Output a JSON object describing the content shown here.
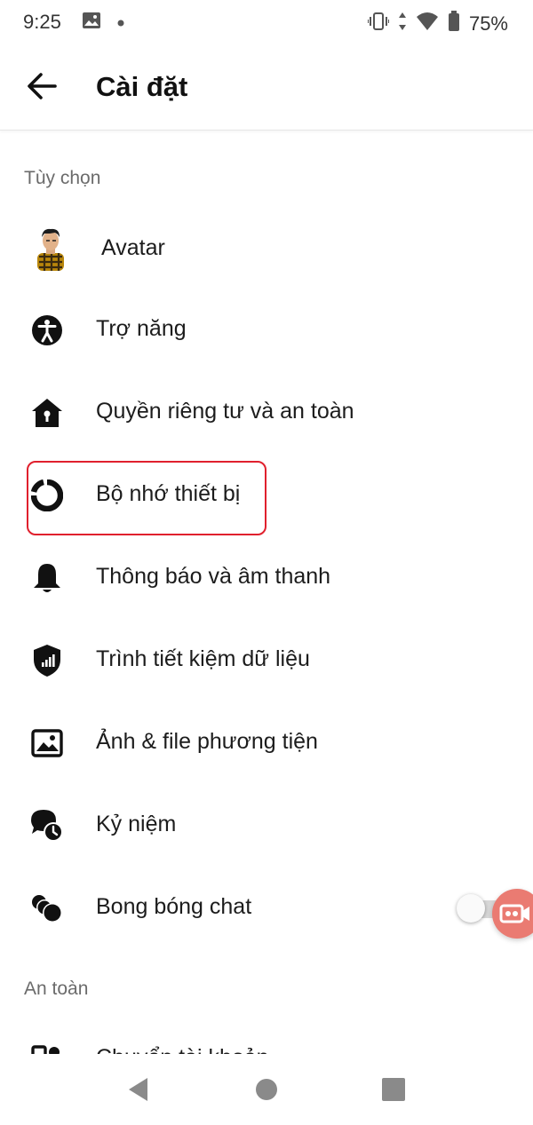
{
  "status_bar": {
    "time": "9:25",
    "battery": "75%",
    "icons": [
      "image-icon",
      "dot-icon",
      "vibrate-icon",
      "data-arrows-icon",
      "wifi-icon",
      "battery-icon"
    ]
  },
  "header": {
    "title": "Cài đặt",
    "back_icon": "arrow-left-icon"
  },
  "sections": {
    "preferences": {
      "title": "Tùy chọn",
      "items": [
        {
          "label": "Avatar",
          "icon": "avatar-image"
        },
        {
          "label": "Trợ năng",
          "icon": "accessibility-icon"
        },
        {
          "label": "Quyền riêng tư và an toàn",
          "icon": "privacy-house-icon"
        },
        {
          "label": "Bộ nhớ thiết bị",
          "icon": "storage-ring-icon",
          "highlighted": true
        },
        {
          "label": "Thông báo và âm thanh",
          "icon": "bell-icon"
        },
        {
          "label": "Trình tiết kiệm dữ liệu",
          "icon": "data-saver-shield-icon"
        },
        {
          "label": "Ảnh & file phương tiện",
          "icon": "photo-icon"
        },
        {
          "label": "Kỷ niệm",
          "icon": "memories-clock-icon"
        },
        {
          "label": "Bong bóng chat",
          "icon": "chat-bubbles-icon",
          "toggle": false
        }
      ]
    },
    "safety": {
      "title": "An toàn",
      "items": [
        {
          "label": "Chuyển tài khoản",
          "icon": "switch-account-icon"
        }
      ]
    }
  },
  "colors": {
    "highlight": "#e0202d",
    "floating_button": "#ea7b72"
  },
  "nav_bar": {
    "buttons": [
      "back-triangle-icon",
      "home-circle-icon",
      "recents-square-icon"
    ]
  }
}
